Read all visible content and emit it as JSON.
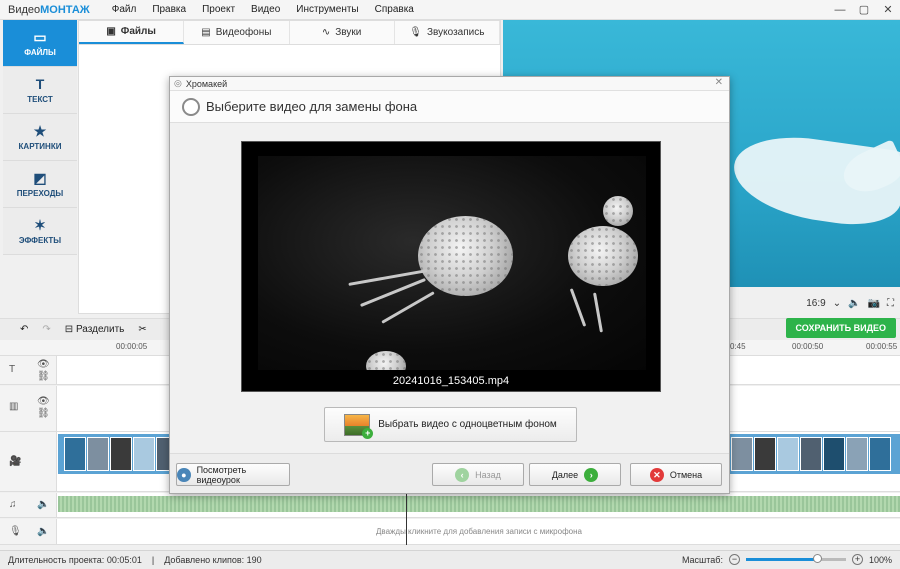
{
  "app": {
    "title_plain": "Видео",
    "title_accent": "МОНТАЖ"
  },
  "menu": [
    "Файл",
    "Правка",
    "Проект",
    "Видео",
    "Инструменты",
    "Справка"
  ],
  "window_controls": {
    "minimize": "—",
    "maximize": "▢",
    "close": "✕"
  },
  "nav": [
    {
      "label": "ФАЙЛЫ",
      "icon": "folder-icon",
      "glyph": "▭",
      "active": true
    },
    {
      "label": "ТЕКСТ",
      "icon": "text-icon",
      "glyph": "T",
      "active": false
    },
    {
      "label": "КАРТИНКИ",
      "icon": "star-icon",
      "glyph": "★",
      "active": false
    },
    {
      "label": "ПЕРЕХОДЫ",
      "icon": "transition-icon",
      "glyph": "◩",
      "active": false
    },
    {
      "label": "ЭФФЕКТЫ",
      "icon": "wand-icon",
      "glyph": "✶",
      "active": false
    }
  ],
  "media_tabs": [
    {
      "label": "Файлы",
      "icon": "image-icon",
      "glyph": "▣",
      "active": true
    },
    {
      "label": "Видеофоны",
      "icon": "video-bg-icon",
      "glyph": "▤",
      "active": false
    },
    {
      "label": "Звуки",
      "icon": "waveform-icon",
      "glyph": "∿",
      "active": false
    },
    {
      "label": "Звукозапись",
      "icon": "microphone-icon",
      "glyph": "🎙",
      "active": false
    }
  ],
  "preview": {
    "aspect": "16:9"
  },
  "toolbar": {
    "split_label": "Разделить",
    "save_label": "СОХРАНИТЬ ВИДЕО"
  },
  "ruler": {
    "left_ticks": [
      "00:00:05"
    ],
    "right_ticks": [
      "0:45",
      "00:00:50",
      "00:00:55"
    ]
  },
  "mic_hint": "Дважды кликните для добавления записи с микрофона",
  "status": {
    "duration_label": "Длительность проекта:",
    "duration_value": "00:05:01",
    "clips_label": "Добавлено клипов:",
    "clips_value": "190",
    "zoom_label": "Масштаб:",
    "zoom_value": "100%",
    "zoom_level": 0.72
  },
  "dialog": {
    "window_title": "Хромакей",
    "heading": "Выберите видео для замены фона",
    "file_name": "20241016_153405.mp4",
    "choose_button": "Выбрать видео с одноцветным фоном",
    "tutorial_button": "Посмотреть видеоурок",
    "back_button": "Назад",
    "next_button": "Далее",
    "cancel_button": "Отмена",
    "close": "✕"
  },
  "colors": {
    "accent": "#1a8ed8",
    "save_green": "#2db34a",
    "next_green": "#3cae3c",
    "cancel_red": "#e23a3a"
  }
}
